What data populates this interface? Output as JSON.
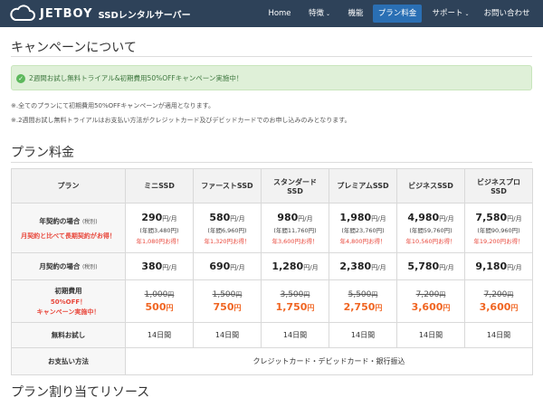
{
  "header": {
    "brand": "JETBOY",
    "subtitle": "SSDレンタルサーバー",
    "nav": [
      {
        "label": "Home",
        "dropdown": false,
        "active": false
      },
      {
        "label": "特徴",
        "dropdown": true,
        "active": false
      },
      {
        "label": "機能",
        "dropdown": false,
        "active": false
      },
      {
        "label": "プラン料金",
        "dropdown": false,
        "active": true
      },
      {
        "label": "サポート",
        "dropdown": true,
        "active": false
      },
      {
        "label": "お問い合わせ",
        "dropdown": false,
        "active": false
      }
    ],
    "caret": "⌄",
    "colors": {
      "bar": "#2e4259",
      "active": "#2a6fb4"
    }
  },
  "campaign": {
    "title": "キャンペーンについて",
    "alert": "2週間お試し無料トライアル&初期費用50%OFFキャンペーン実施中！",
    "alert_icon": "check-circle-icon",
    "notes": [
      "※.全てのプランにて初期費用50%OFFキャンペーンが適用となります。",
      "※.2週間お試し無料トライアルはお支払い方法がクレジットカード及びデビッドカードでのお申し込みのみとなります。"
    ]
  },
  "pricing": {
    "title": "プラン料金",
    "header": [
      "プラン",
      "ミニSSD",
      "ファーストSSD",
      "スタンダード\nSSD",
      "プレミアムSSD",
      "ビジネスSSD",
      "ビジネスプロ\nSSD"
    ],
    "annual": {
      "label": "年契約の場合",
      "label_note": "(税別)",
      "promo": "月契約と比べて長期契約がお得！",
      "cells": [
        {
          "price": "290",
          "unit": "円/月",
          "yearly": "(年間3,480円)",
          "save": "年1,080円お得！"
        },
        {
          "price": "580",
          "unit": "円/月",
          "yearly": "(年間6,960円)",
          "save": "年1,320円お得！"
        },
        {
          "price": "980",
          "unit": "円/月",
          "yearly": "(年間11,760円)",
          "save": "年3,600円お得！"
        },
        {
          "price": "1,980",
          "unit": "円/月",
          "yearly": "(年間23,760円)",
          "save": "年4,800円お得！"
        },
        {
          "price": "4,980",
          "unit": "円/月",
          "yearly": "(年間59,760円)",
          "save": "年10,560円お得！"
        },
        {
          "price": "7,580",
          "unit": "円/月",
          "yearly": "(年間90,960円)",
          "save": "年19,200円お得！"
        }
      ]
    },
    "monthly": {
      "label": "月契約の場合",
      "label_note": "(税別)",
      "cells": [
        {
          "price": "380",
          "unit": "円/月"
        },
        {
          "price": "690",
          "unit": "円/月"
        },
        {
          "price": "1,280",
          "unit": "円/月"
        },
        {
          "price": "2,380",
          "unit": "円/月"
        },
        {
          "price": "5,780",
          "unit": "円/月"
        },
        {
          "price": "9,180",
          "unit": "円/月"
        }
      ]
    },
    "initial": {
      "label": "初期費用",
      "promo1": "50%OFF！",
      "promo2": "キャンペーン実施中！",
      "cells": [
        {
          "old": "1,000",
          "old_unit": "円",
          "new": "500",
          "new_unit": "円"
        },
        {
          "old": "1,500",
          "old_unit": "円",
          "new": "750",
          "new_unit": "円"
        },
        {
          "old": "3,500",
          "old_unit": "円",
          "new": "1,750",
          "new_unit": "円"
        },
        {
          "old": "5,500",
          "old_unit": "円",
          "new": "2,750",
          "new_unit": "円"
        },
        {
          "old": "7,200",
          "old_unit": "円",
          "new": "3,600",
          "new_unit": "円"
        },
        {
          "old": "7,200",
          "old_unit": "円",
          "new": "3,600",
          "new_unit": "円"
        }
      ]
    },
    "trial": {
      "label": "無料お試し",
      "cells": [
        "14日間",
        "14日間",
        "14日間",
        "14日間",
        "14日間",
        "14日間"
      ]
    },
    "payment": {
      "label": "お支払い方法",
      "value": "クレジットカード・デビッドカード・銀行振込"
    }
  },
  "resources": {
    "title": "プラン割り当てリソース"
  }
}
